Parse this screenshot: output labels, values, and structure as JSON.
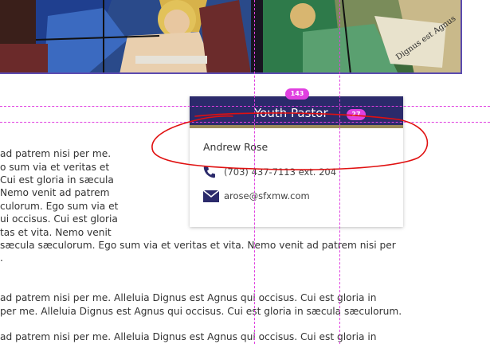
{
  "card": {
    "title": "Youth Pastor",
    "name": "Andrew Rose",
    "phone": "(703) 437-7113  ext. 204",
    "email": "arose@sfxmw.com",
    "icons": {
      "phone": "phone-icon",
      "email": "envelope-icon"
    }
  },
  "body_text": {
    "block1": [
      "ad patrem nisi per me.",
      "o sum via et veritas et",
      " Cui est gloria in sæcula",
      " Nemo venit ad patrem",
      "culorum. Ego sum via et",
      "ui occisus. Cui est gloria",
      "tas et vita. Nemo venit",
      "sæcula sæculorum. Ego sum via et veritas et vita. Nemo venit ad patrem nisi per",
      "."
    ],
    "block2": [
      "ad patrem nisi per me. Alleluia Dignus est Agnus qui occisus. Cui est gloria in",
      "per me. Alleluia Dignus est Agnus qui occisus. Cui est gloria in sæcula sæculorum."
    ],
    "block3": [
      "ad patrem nisi per me. Alleluia Dignus est Agnus qui occisus. Cui est gloria in"
    ]
  },
  "banner": {
    "scroll_text": "Dignus est Agnus"
  },
  "guides": {
    "width_badge": "143",
    "height_badge": "27"
  },
  "colors": {
    "card_header": "#2b2a6b",
    "card_header_border": "#9b8b5a",
    "guide": "#e040e0",
    "annotation": "#e01010",
    "icon": "#2b2a6b"
  }
}
